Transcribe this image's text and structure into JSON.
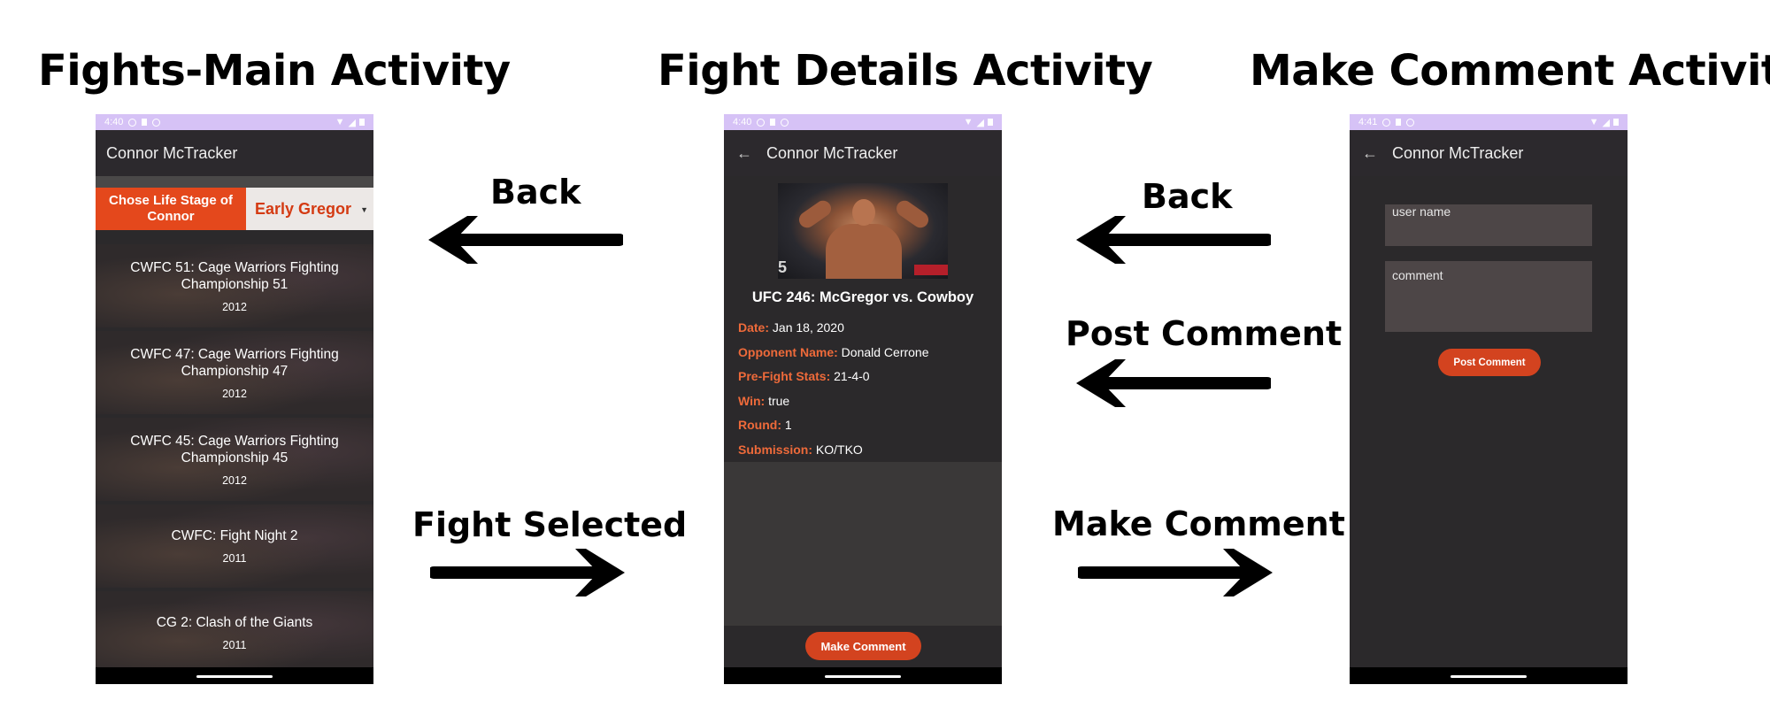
{
  "headings": {
    "fights_main": "Fights-Main Activity",
    "fight_details": "Fight Details Activity",
    "make_comment": "Make Comment Activity"
  },
  "arrows": {
    "back_1": "Back",
    "fight_selected": "Fight Selected",
    "back_2": "Back",
    "post_comment": "Post Comment",
    "make_comment": "Make Comment"
  },
  "status_times": {
    "main": "4:40",
    "details": "4:40",
    "comment": "4:41"
  },
  "app_title": "Connor McTracker",
  "main_screen": {
    "stage_label": "Chose Life Stage of Connor",
    "stage_value": "Early Gregor",
    "fights": [
      {
        "title": "CWFC 51: Cage Warriors Fighting Championship 51",
        "year": "2012"
      },
      {
        "title": "CWFC 47: Cage Warriors Fighting Championship 47",
        "year": "2012"
      },
      {
        "title": "CWFC 45: Cage Warriors Fighting Championship 45",
        "year": "2012"
      },
      {
        "title": "CWFC: Fight Night 2",
        "year": "2011"
      },
      {
        "title": "CG 2: Clash of the Giants",
        "year": "2011"
      }
    ]
  },
  "details_screen": {
    "photo_number": "5",
    "fight_name": "UFC 246: McGregor vs. Cowboy",
    "rows": [
      {
        "key": "Date:",
        "value": "Jan 18, 2020"
      },
      {
        "key": "Opponent Name:",
        "value": "Donald Cerrone"
      },
      {
        "key": "Pre-Fight Stats:",
        "value": "21-4-0"
      },
      {
        "key": "Win:",
        "value": "true"
      },
      {
        "key": "Round:",
        "value": "1"
      },
      {
        "key": "Submission:",
        "value": "KO/TKO"
      }
    ],
    "make_comment_button": "Make Comment"
  },
  "comment_screen": {
    "username_placeholder": "user name",
    "comment_placeholder": "comment",
    "post_button": "Post Comment"
  },
  "colors": {
    "accent": "#e4481c",
    "button": "#d3431f",
    "status_bar": "#d6c2f6",
    "app_bg": "#2b292b"
  }
}
